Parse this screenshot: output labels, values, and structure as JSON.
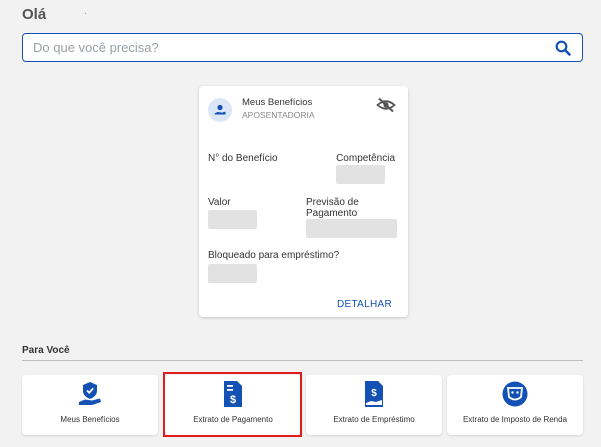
{
  "header": {
    "greeting": "Olá",
    "greeting_dot": "."
  },
  "search": {
    "placeholder": "Do que você precisa?"
  },
  "benefit_card": {
    "title": "Meus Benefícios",
    "subtitle": "APOSENTADORIA",
    "benefit_number_label": "N° do Benefício",
    "competencia_label": "Competência",
    "valor_label": "Valor",
    "previsao_label_line1": "Previsão de",
    "previsao_label_line2": "Pagamento",
    "bloqueado_label": "Bloqueado para empréstimo?",
    "detail_link": "DETALHAR"
  },
  "section": {
    "title": "Para Você"
  },
  "tiles": [
    {
      "label": "Meus Benefícios",
      "icon": "hand-shield-icon"
    },
    {
      "label": "Extrato de Pagamento",
      "icon": "payment-doc-icon"
    },
    {
      "label": "Extrato de Empréstimo",
      "icon": "loan-doc-icon"
    },
    {
      "label": "Extrato de Imposto de Renda",
      "icon": "lion-badge-icon"
    }
  ],
  "colors": {
    "primary": "#1351b4",
    "highlight": "#e01c1c",
    "background": "#f2f2f2",
    "mask": "#e2e2e2"
  }
}
